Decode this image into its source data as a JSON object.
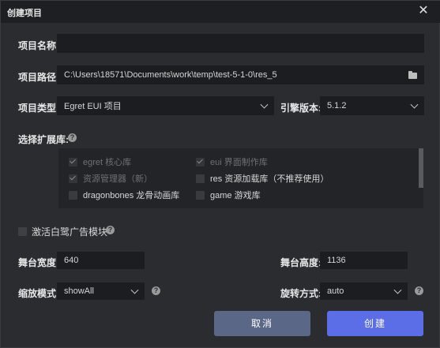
{
  "window": {
    "title": "创建项目"
  },
  "form": {
    "project_name_label": "项目名称:",
    "project_name_value": "",
    "project_path_label": "项目路径:",
    "project_path_value": "C:\\Users\\18571\\Documents\\work\\temp\\test-5-1-0\\res_5",
    "project_type_label": "项目类型:",
    "project_type_value": "Egret EUI 项目",
    "engine_version_label": "引擎版本:",
    "engine_version_value": "5.1.2",
    "extensions_label": "选择扩展库:",
    "extensions": [
      {
        "label": "egret 核心库",
        "checked": true,
        "disabled": true
      },
      {
        "label": "eui 界面制作库",
        "checked": true,
        "disabled": true
      },
      {
        "label": "资源管理器（新）",
        "checked": true,
        "disabled": true
      },
      {
        "label": "res 资源加载库（不推荐使用）",
        "checked": false,
        "disabled": false
      },
      {
        "label": "dragonbones 龙骨动画库",
        "checked": false,
        "disabled": false
      },
      {
        "label": "game 游戏库",
        "checked": false,
        "disabled": false
      }
    ],
    "activate_ad_label": "激活白鹭广告模块",
    "stage_width_label": "舞台宽度:",
    "stage_width_value": "640",
    "stage_height_label": "舞台高度:",
    "stage_height_value": "1136",
    "scale_mode_label": "缩放模式:",
    "scale_mode_value": "showAll",
    "rotation_label": "旋转方式:",
    "rotation_value": "auto"
  },
  "buttons": {
    "cancel": "取消",
    "create": "创建"
  },
  "icons": {
    "help": "?",
    "close": "✕"
  }
}
